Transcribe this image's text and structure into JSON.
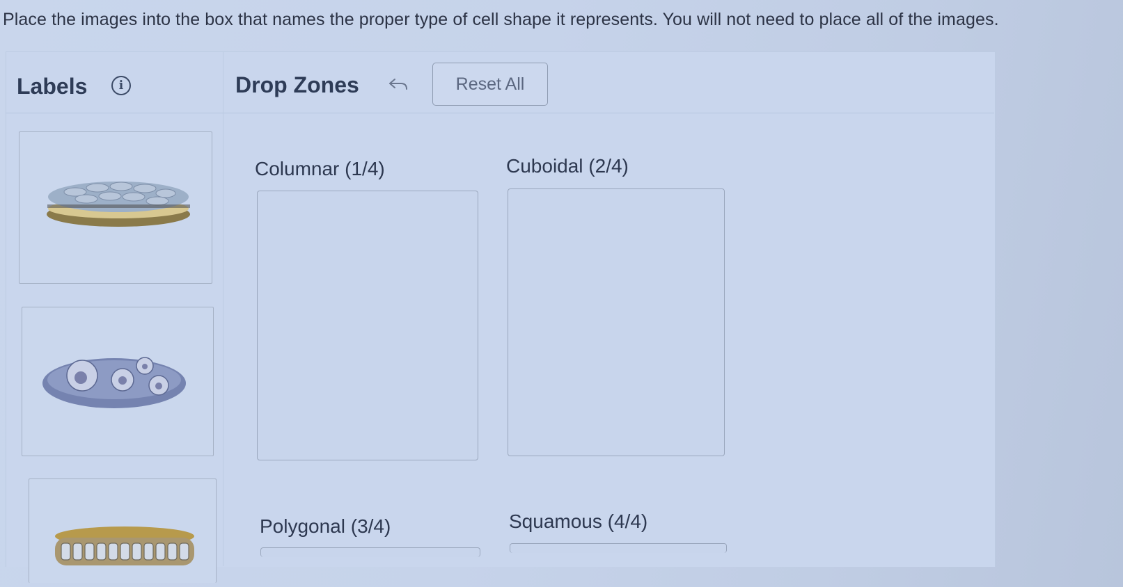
{
  "instruction": "Place the images into the box that names the proper type of cell shape it represents. You will not need to place all of the images.",
  "header": {
    "labels_title": "Labels",
    "drop_zones_title": "Drop Zones",
    "reset_label": "Reset All"
  },
  "labels": [
    {
      "icon": "squamous-cell-layer-image"
    },
    {
      "icon": "polygonal-cell-cluster-image"
    },
    {
      "icon": "columnar-cell-layer-image"
    }
  ],
  "drop_zones": [
    {
      "label": "Columnar (1/4)"
    },
    {
      "label": "Cuboidal (2/4)"
    },
    {
      "label": "Polygonal (3/4)"
    },
    {
      "label": "Squamous (4/4)"
    }
  ]
}
